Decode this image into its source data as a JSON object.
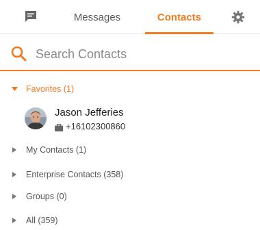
{
  "colors": {
    "accent": "#f47a20",
    "text": "#333333",
    "muted": "#555555",
    "placeholder": "#8a8a8a",
    "divider": "#e2e2e2"
  },
  "header": {
    "tabs": [
      {
        "icon": "chat-icon",
        "label": ""
      },
      {
        "label": "Messages",
        "active": false
      },
      {
        "label": "Contacts",
        "active": true
      },
      {
        "icon": "gear-icon",
        "label": ""
      }
    ]
  },
  "search": {
    "icon": "search-icon",
    "placeholder": "Search Contacts",
    "value": ""
  },
  "sections": {
    "favorites": {
      "label": "Favorites (1)",
      "expanded": true
    },
    "my_contacts": {
      "label": "My Contacts (1)",
      "expanded": false
    },
    "enterprise_contacts": {
      "label": "Enterprise Contacts (358)",
      "expanded": false
    },
    "groups": {
      "label": "Groups (0)",
      "expanded": false
    },
    "all": {
      "label": "All (359)",
      "expanded": false
    }
  },
  "favorites_contacts": [
    {
      "name": "Jason Jefferies",
      "phone_icon": "briefcase-icon",
      "phone": "+16102300860",
      "avatar": "avatar-photo"
    }
  ]
}
